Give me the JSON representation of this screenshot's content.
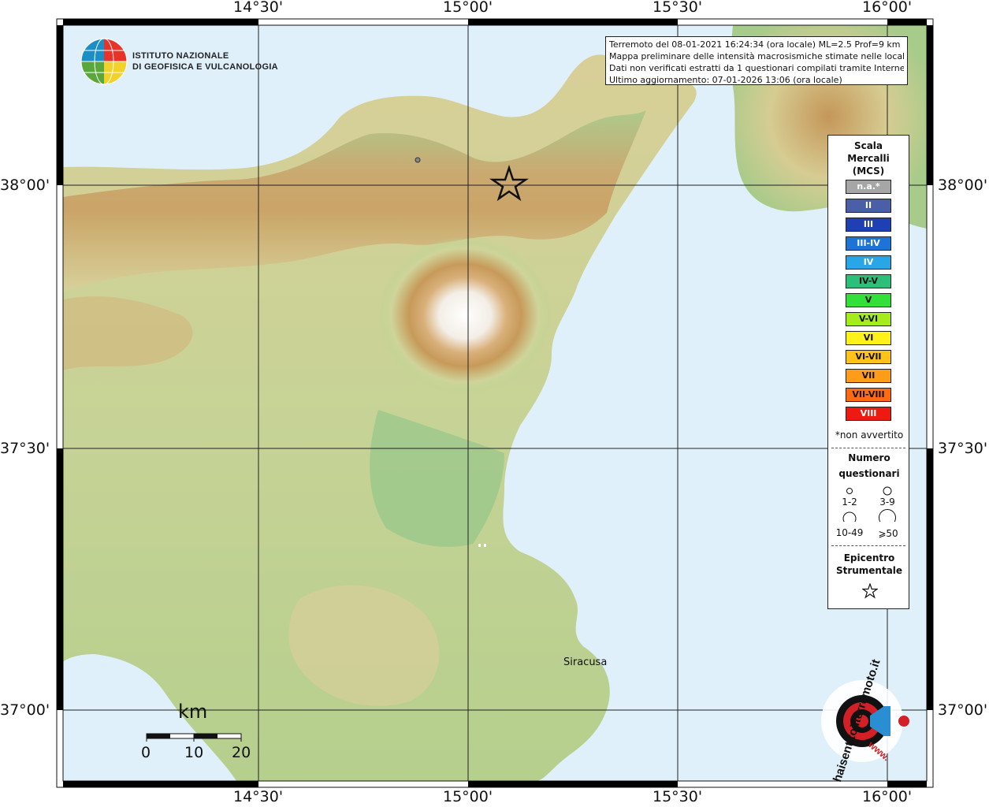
{
  "map": {
    "lon_labels_top": [
      "14°30'",
      "15°00'",
      "15°30'",
      "16°00'"
    ],
    "lon_labels_bottom": [
      "14°30'",
      "15°00'",
      "15°30'",
      "16°00'"
    ],
    "lat_labels_left": [
      "38°00'",
      "37°30'",
      "37°00'"
    ],
    "lat_labels_right": [
      "38°00'",
      "37°30'",
      "37°00'"
    ],
    "city": "Siracusa",
    "colors": {
      "sea": "#dff0fb",
      "land_low": "#9fc98c",
      "land_mid": "#d8d29a",
      "land_high": "#b98a4f",
      "peak": "#ffffff",
      "grid": "#222222"
    }
  },
  "logo": {
    "line1": "ISTITUTO NAZIONALE",
    "line2": "DI GEOFISICA E VULCANOLOGIA"
  },
  "info": {
    "line1": "Terremoto del 08-01-2021 16:24:34 (ora locale) ML=2.5 Prof=9 km",
    "line2": "Mappa preliminare delle intensità macrosismiche stimate nelle località",
    "line3": "Dati non verificati estratti da 1 questionari compilati tramite Internet.",
    "line4": "Ultimo aggiornamento: 07-01-2026 13:06 (ora locale)"
  },
  "legend": {
    "title1": "Scala",
    "title2": "Mercalli",
    "title3": "(MCS)",
    "classes": [
      {
        "label": "n.a.*",
        "color": "#a6a6a6",
        "text": "#ffffff"
      },
      {
        "label": "II",
        "color": "#4a5fa8",
        "text": "#ffffff"
      },
      {
        "label": "III",
        "color": "#1f3fb4",
        "text": "#ffffff"
      },
      {
        "label": "III-IV",
        "color": "#1e74d6",
        "text": "#ffffff"
      },
      {
        "label": "IV",
        "color": "#28a6e6",
        "text": "#ffffff"
      },
      {
        "label": "IV-V",
        "color": "#2bbf7a",
        "text": "#111111"
      },
      {
        "label": "V",
        "color": "#33e03a",
        "text": "#111111"
      },
      {
        "label": "V-VI",
        "color": "#a6ec1c",
        "text": "#111111"
      },
      {
        "label": "VI",
        "color": "#fff21a",
        "text": "#111111"
      },
      {
        "label": "VI-VII",
        "color": "#ffc21a",
        "text": "#111111"
      },
      {
        "label": "VII",
        "color": "#ff9c1a",
        "text": "#111111"
      },
      {
        "label": "VII-VIII",
        "color": "#ff6a12",
        "text": "#111111"
      },
      {
        "label": "VIII",
        "color": "#ee1a12",
        "text": "#ffffff"
      }
    ],
    "not_felt": "*non avvertito",
    "num_title1": "Numero",
    "num_title2": "questionari",
    "sizes": [
      "1-2",
      "3-9",
      "10-49",
      "⩾50"
    ],
    "epi_title1": "Epicentro",
    "epi_title2": "Strumentale"
  },
  "scale_bar": {
    "unit": "km",
    "ticks": [
      "0",
      "10",
      "20"
    ]
  },
  "badge": {
    "text": "haisentitoilterremoto.it",
    "url": "www."
  }
}
